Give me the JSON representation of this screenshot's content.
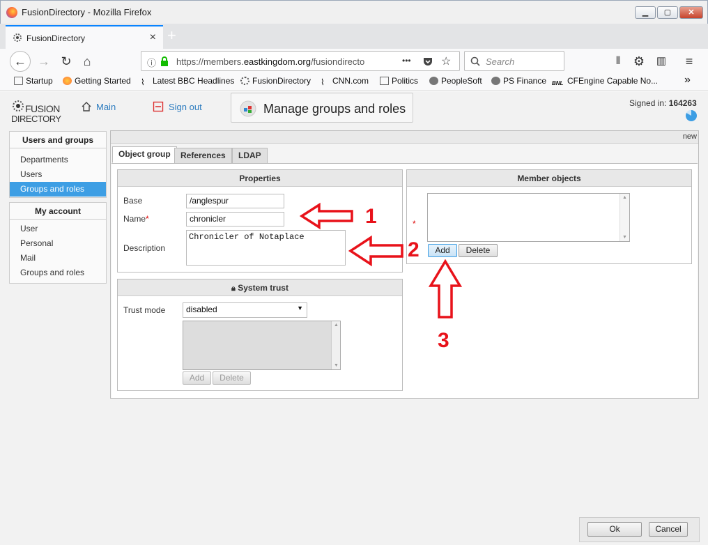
{
  "window": {
    "title": "FusionDirectory - Mozilla Firefox",
    "minimize": "▁",
    "maximize": "▢",
    "close": "✕"
  },
  "tab": {
    "label": "FusionDirectory",
    "close": "×",
    "new_tab": "+"
  },
  "nav": {
    "url_prefix": "https://members.",
    "url_host": "eastkingdom.org",
    "url_suffix": "/fusiondirecto",
    "url_more": "•••",
    "search_placeholder": "Search"
  },
  "bookmarks": [
    {
      "label": "Startup",
      "icon": "folder-icon"
    },
    {
      "label": "Getting Started",
      "icon": "firefox-icon"
    },
    {
      "label": "Latest BBC Headlines",
      "icon": "rss-icon"
    },
    {
      "label": "FusionDirectory",
      "icon": "fusion-icon"
    },
    {
      "label": "CNN.com",
      "icon": "rss-icon"
    },
    {
      "label": "Politics",
      "icon": "folder-icon"
    },
    {
      "label": "PeopleSoft",
      "icon": "globe-icon"
    },
    {
      "label": "PS Finance",
      "icon": "globe-icon"
    },
    {
      "label": "CFEngine Capable No...",
      "icon": "bnl-icon"
    }
  ],
  "header": {
    "logo_line1": "FUSION",
    "logo_line2": "DIRECTORY",
    "main_link": "Main",
    "signout_link": "Sign out",
    "page_title": "Manage groups and roles",
    "signed_in_label": "Signed in:",
    "signed_in_user": "164263"
  },
  "sidebar": {
    "section1": {
      "title": "Users and groups",
      "items": [
        "Departments",
        "Users",
        "Groups and roles"
      ],
      "selected": 2
    },
    "section2": {
      "title": "My account",
      "items": [
        "User",
        "Personal",
        "Mail",
        "Groups and roles"
      ]
    }
  },
  "main": {
    "new_label": "new",
    "tabs": [
      "Object group",
      "References",
      "LDAP"
    ],
    "properties": {
      "title": "Properties",
      "base_label": "Base",
      "base_value": "/anglespur",
      "name_label": "Name",
      "name_value": "chronicler",
      "description_label": "Description",
      "description_value": "Chronicler of Notaplace"
    },
    "system_trust": {
      "title": "System trust",
      "trust_mode_label": "Trust mode",
      "trust_mode_value": "disabled",
      "add_label": "Add",
      "delete_label": "Delete"
    },
    "member_objects": {
      "title": "Member objects",
      "add_label": "Add",
      "delete_label": "Delete"
    }
  },
  "annotations": [
    "1",
    "2",
    "3"
  ],
  "footer": {
    "ok_label": "Ok",
    "cancel_label": "Cancel"
  },
  "colors": {
    "accent": "#3d9ee4",
    "annotation": "#e8121a",
    "link": "#2b7bbf"
  }
}
